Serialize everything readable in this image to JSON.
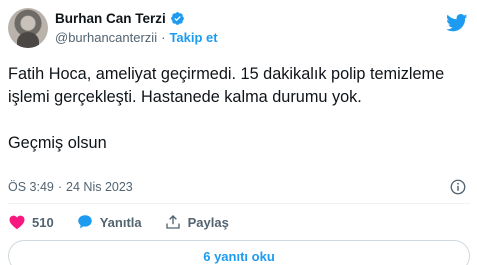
{
  "author": {
    "display_name": "Burhan Can Terzi",
    "handle": "@burhancanterzii",
    "separator": "·",
    "follow_label": "Takip et"
  },
  "tweet": {
    "paragraph_1": "Fatih Hoca, ameliyat geçirmedi. 15 dakikalık polip temizleme işlemi gerçekleşti. Hastanede kalma durumu yok.",
    "paragraph_2": "Geçmiş olsun"
  },
  "meta": {
    "time": "ÖS 3:49",
    "separator": "·",
    "date": "24 Nis 2023"
  },
  "actions": {
    "like_count": "510",
    "reply_label": "Yanıtla",
    "share_label": "Paylaş"
  },
  "replies_button_label": "6 yanıtı oku",
  "icons": {
    "verified": "verified-badge-icon",
    "brand": "twitter-bird-icon",
    "info": "info-icon",
    "like": "heart-icon",
    "reply": "speech-bubble-icon",
    "share": "share-upload-icon"
  },
  "colors": {
    "accent": "#1d9bf0",
    "like": "#f91880",
    "text": "#0f1419",
    "secondary": "#536471"
  }
}
